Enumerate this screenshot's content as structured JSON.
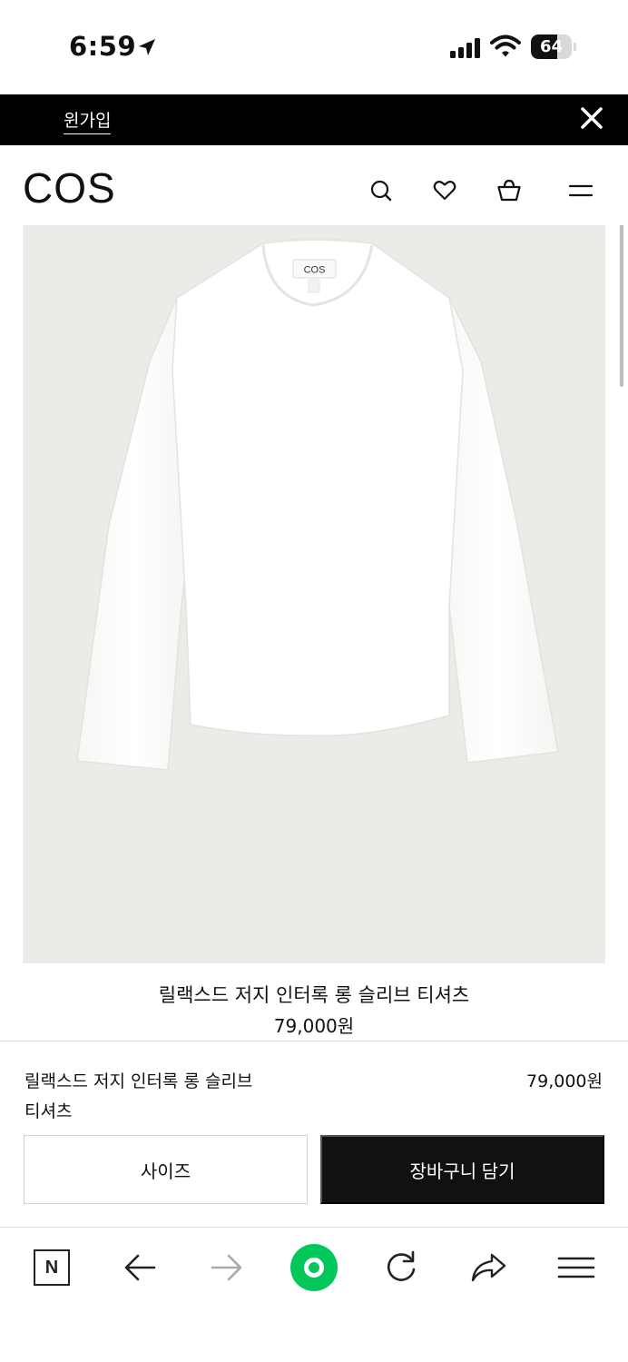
{
  "status_bar": {
    "time": "6:59",
    "battery": "64",
    "battery_level": 0.64
  },
  "banner": {
    "link_label": "윈가입",
    "close_icon": "close-icon"
  },
  "header": {
    "logo": "COS",
    "icons": [
      "search-icon",
      "heart-icon",
      "shopping-bag-icon",
      "menu-icon"
    ]
  },
  "product": {
    "image_tag_text": "COS",
    "name": "릴랙스드 저지 인터록 롱 슬리브 티셔츠",
    "price": "79,000원"
  },
  "sticky_bar": {
    "name_line1": "릴랙스드 저지 인터록 롱 슬리브",
    "name_line2": "티셔츠",
    "price": "79,000원",
    "size_button": "사이즈",
    "cart_button": "장바구니 담기"
  },
  "browser_toolbar": {
    "home_label": "N",
    "icons": [
      "naver-home-icon",
      "back-arrow-icon",
      "forward-arrow-icon",
      "green-dot-icon",
      "refresh-icon",
      "share-icon",
      "menu-icon"
    ]
  },
  "colors": {
    "banner_bg": "#000000",
    "cart_button_bg": "#111111",
    "image_bg": "#ebebe8",
    "accent_green": "#03c75a"
  }
}
